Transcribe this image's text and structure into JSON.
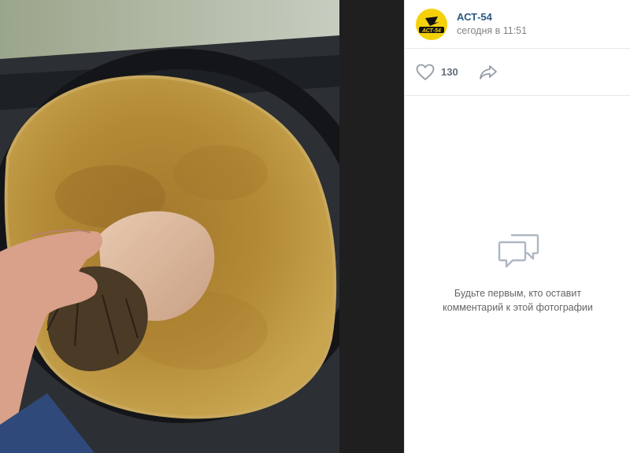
{
  "post": {
    "author_name": "АСТ-54",
    "date": "сегодня в 11:51",
    "avatar_logo_text": "АСТ-54"
  },
  "actions": {
    "likes_count": "130"
  },
  "comments": {
    "empty_line1": "Будьте первым, кто оставит",
    "empty_line2": "комментарий к этой фотографии"
  },
  "colors": {
    "accent": "#2a5885",
    "avatar_bg": "#f5d10a",
    "muted": "#828282"
  },
  "icons": [
    "heart-icon",
    "share-icon",
    "comments-icon"
  ]
}
